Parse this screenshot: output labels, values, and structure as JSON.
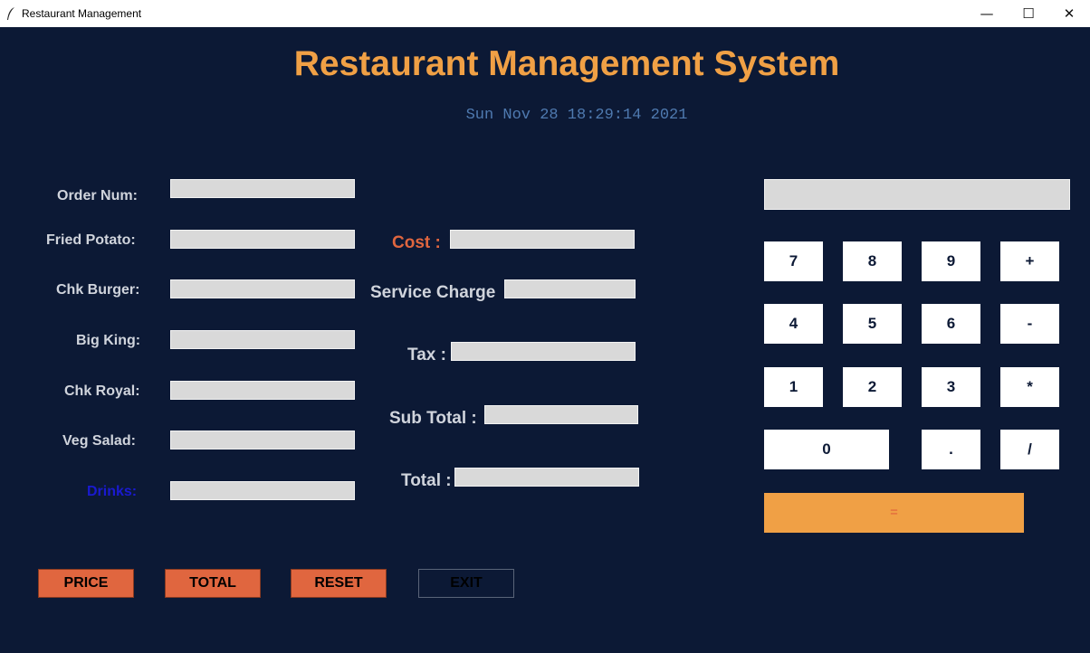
{
  "window": {
    "title": "Restaurant Management",
    "minimize": "—",
    "maximize": "☐",
    "close": "✕"
  },
  "heading": "Restaurant Management System",
  "datetime": "Sun Nov 28 18:29:14 2021",
  "colors": {
    "background": "#0c1935",
    "accent": "#f0a045",
    "button": "#e0663f",
    "cost_label": "#e0663f",
    "drinks_label": "#1a1ad0",
    "date": "#4f7ab0"
  },
  "order_fields": [
    {
      "label": "Order Num:",
      "value": ""
    },
    {
      "label": "Fried Potato:",
      "value": ""
    },
    {
      "label": "Chk Burger:",
      "value": ""
    },
    {
      "label": "Big King:",
      "value": ""
    },
    {
      "label": "Chk Royal:",
      "value": ""
    },
    {
      "label": "Veg Salad:",
      "value": ""
    },
    {
      "label": "Drinks:",
      "value": ""
    }
  ],
  "totals": {
    "cost": {
      "label": "Cost :",
      "value": ""
    },
    "service": {
      "label": "Service Charge",
      "value": ""
    },
    "tax": {
      "label": "Tax :",
      "value": ""
    },
    "subtotal": {
      "label": "Sub Total :",
      "value": ""
    },
    "total": {
      "label": "Total :",
      "value": ""
    }
  },
  "calculator": {
    "display": "",
    "keys": [
      "7",
      "8",
      "9",
      "+",
      "4",
      "5",
      "6",
      "-",
      "1",
      "2",
      "3",
      "*",
      "0",
      ".",
      "/"
    ],
    "equals": "="
  },
  "buttons": {
    "price": "PRICE",
    "total": "TOTAL",
    "reset": "RESET",
    "exit": "EXIT"
  }
}
